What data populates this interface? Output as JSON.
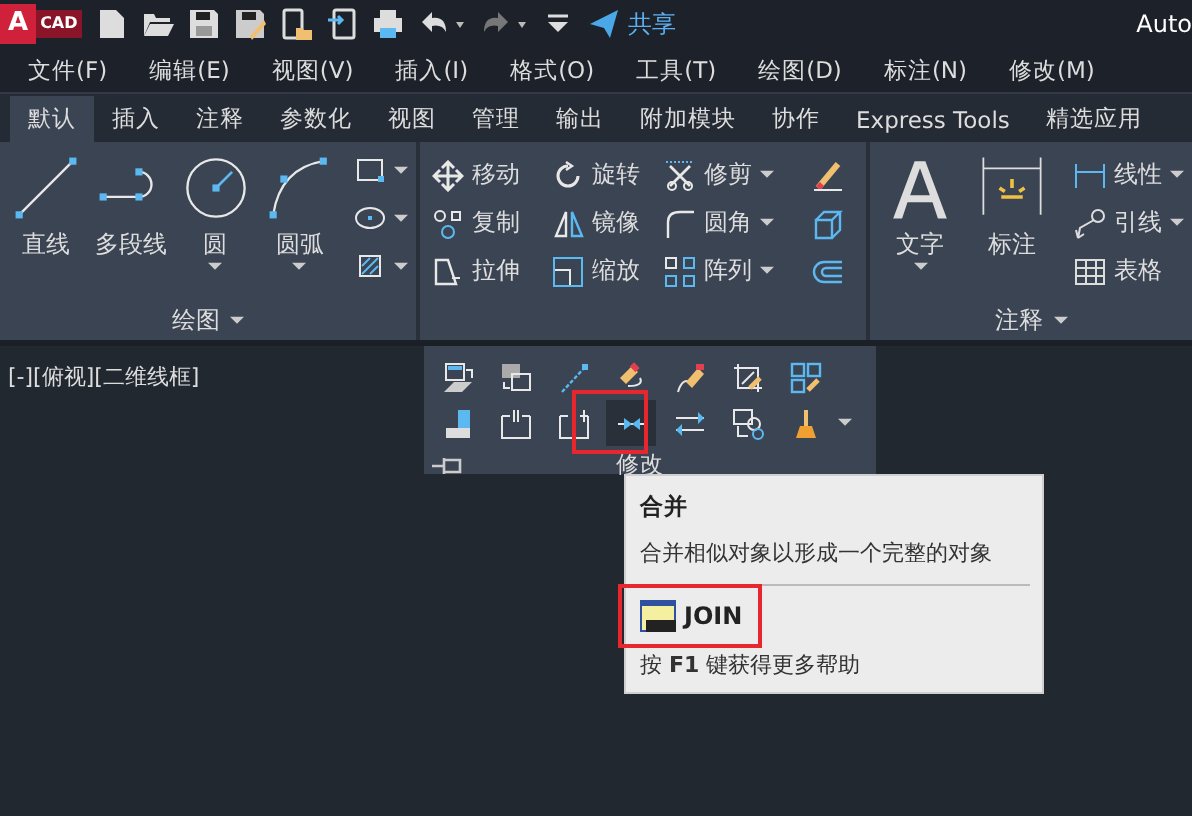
{
  "title_bar": {
    "logo": "A",
    "logo_badge": "CAD",
    "share": "共享",
    "title": "Auto"
  },
  "menu": [
    "文件(F)",
    "编辑(E)",
    "视图(V)",
    "插入(I)",
    "格式(O)",
    "工具(T)",
    "绘图(D)",
    "标注(N)",
    "修改(M)"
  ],
  "ribbon_tabs": [
    {
      "label": "默认",
      "selected": true
    },
    {
      "label": "插入",
      "selected": false
    },
    {
      "label": "注释",
      "selected": false
    },
    {
      "label": "参数化",
      "selected": false
    },
    {
      "label": "视图",
      "selected": false
    },
    {
      "label": "管理",
      "selected": false
    },
    {
      "label": "输出",
      "selected": false
    },
    {
      "label": "附加模块",
      "selected": false
    },
    {
      "label": "协作",
      "selected": false
    },
    {
      "label": "Express Tools",
      "selected": false
    },
    {
      "label": "精选应用",
      "selected": false
    }
  ],
  "draw_panel": {
    "tools": [
      {
        "label": "直线",
        "has_menu": false
      },
      {
        "label": "多段线",
        "has_menu": false
      },
      {
        "label": "圆",
        "has_menu": true
      },
      {
        "label": "圆弧",
        "has_menu": true
      }
    ],
    "footer": "绘图"
  },
  "modify_panel": {
    "tools": [
      {
        "label": "移动",
        "has_menu": false
      },
      {
        "label": "旋转",
        "has_menu": false
      },
      {
        "label": "修剪",
        "has_menu": true
      },
      {
        "label": "复制",
        "has_menu": false
      },
      {
        "label": "镜像",
        "has_menu": false
      },
      {
        "label": "圆角",
        "has_menu": true
      },
      {
        "label": "拉伸",
        "has_menu": false
      },
      {
        "label": "缩放",
        "has_menu": false
      },
      {
        "label": "阵列",
        "has_menu": true
      }
    ]
  },
  "annotation_panel": {
    "big_tools": [
      {
        "label": "文字",
        "has_menu": true
      },
      {
        "label": "标注",
        "has_menu": false
      }
    ],
    "tools": [
      {
        "label": "线性",
        "has_menu": true
      },
      {
        "label": "引线",
        "has_menu": true
      },
      {
        "label": "表格",
        "has_menu": false
      }
    ],
    "footer": "注释"
  },
  "viewport": {
    "label": "[-][俯视][二维线框]"
  },
  "modify_expanded": {
    "tools": [
      {
        "selected": false
      },
      {
        "selected": false
      },
      {
        "selected": false
      },
      {
        "selected": false
      },
      {
        "selected": false
      },
      {
        "selected": false
      },
      {
        "selected": false
      },
      {
        "selected": false
      },
      {
        "selected": false
      },
      {
        "selected": false
      },
      {
        "selected": true
      },
      {
        "selected": false
      },
      {
        "selected": false
      },
      {
        "selected": false
      }
    ],
    "footer": "修改"
  },
  "tooltip": {
    "title": "合并",
    "description": "合并相似对象以形成一个完整的对象",
    "command": "JOIN",
    "help": "按 **F1** 键获得更多帮助"
  }
}
